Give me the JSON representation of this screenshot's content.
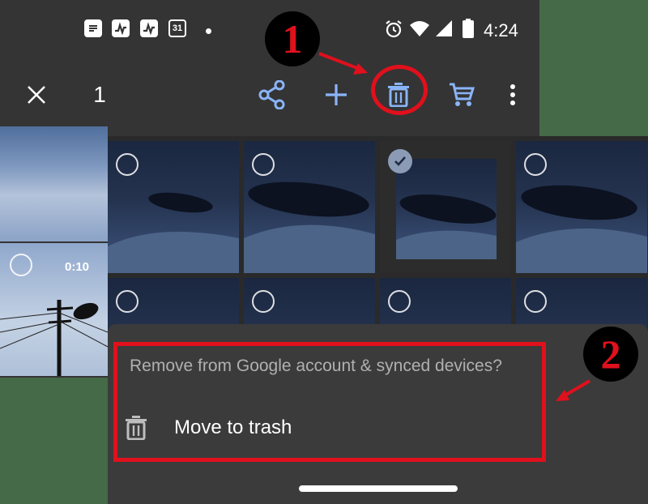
{
  "statusbar": {
    "notif_icons": [
      "notes-icon",
      "pulse-app-icon",
      "pulse-app-icon",
      "calendar-icon"
    ],
    "calendar_day": "31",
    "time": "4:24"
  },
  "toolbar": {
    "selected_count": "1"
  },
  "grid": {
    "video_duration": "0:10"
  },
  "sheet": {
    "question": "Remove from Google account & synced devices?",
    "action_label": "Move to trash"
  },
  "annotations": {
    "step1": "1",
    "step2": "2",
    "color": "#e0101c"
  },
  "colors": {
    "accent_icon": "#8ab4f8",
    "highlight": "#e0101c"
  }
}
